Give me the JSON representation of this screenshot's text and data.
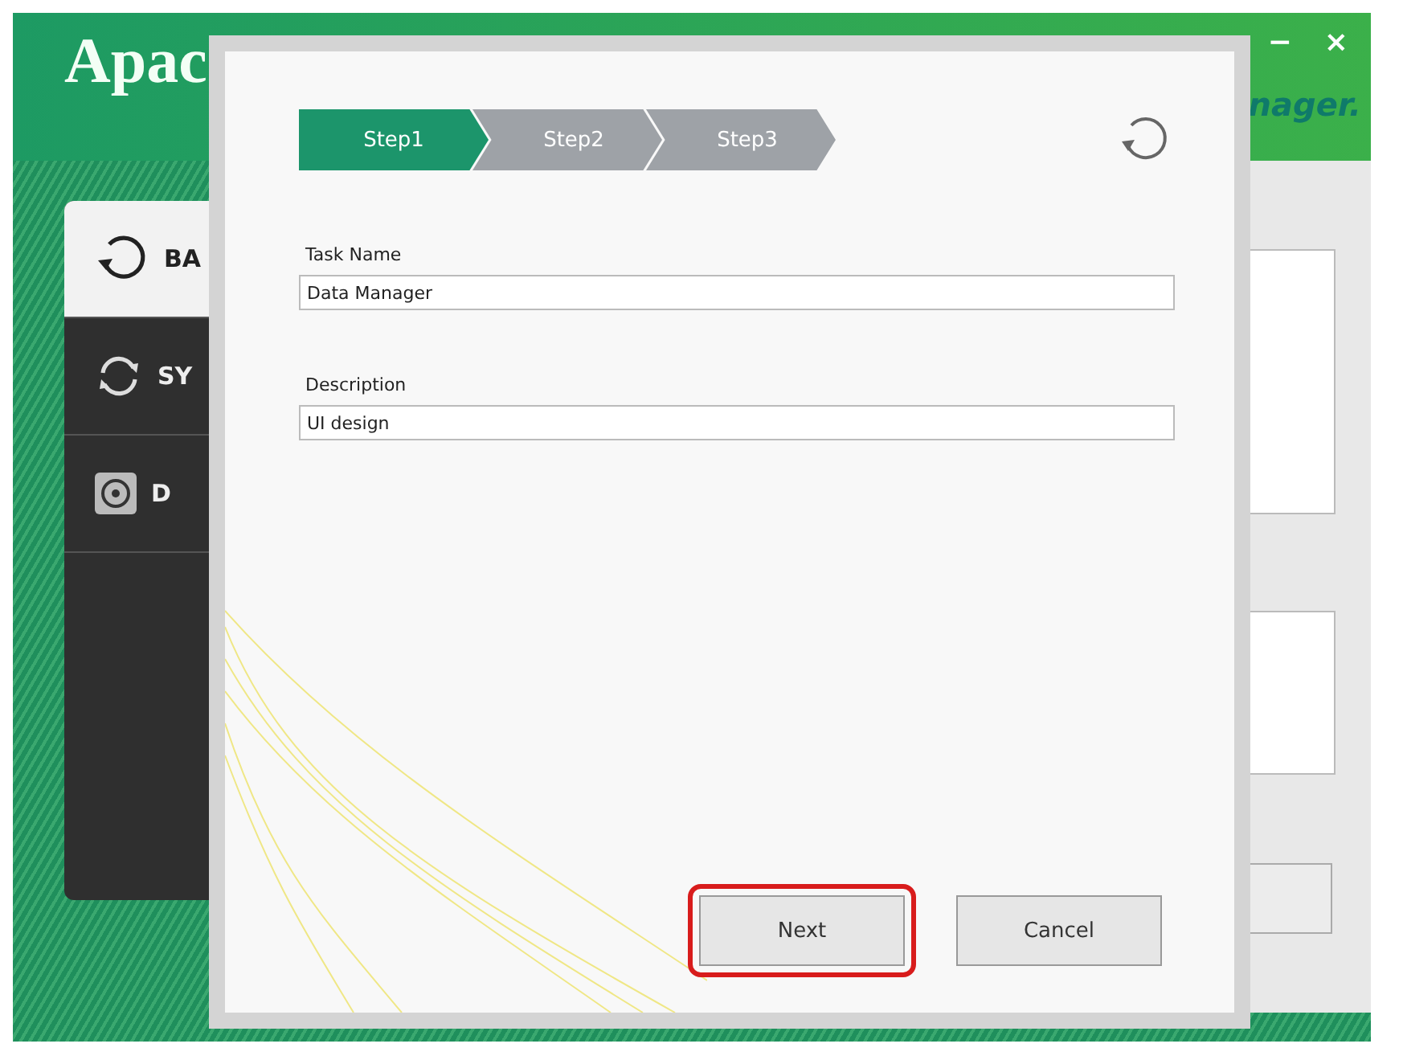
{
  "app_window": {
    "title": "Apac",
    "subtitle": "nager.",
    "window_controls": [
      "−",
      "×"
    ],
    "sidebar": {
      "items": [
        {
          "kind": "backup",
          "label": "BA",
          "selected": true
        },
        {
          "kind": "sync",
          "label": "SY",
          "selected": false
        },
        {
          "kind": "disk",
          "label": "D",
          "selected": false
        }
      ]
    }
  },
  "dialog": {
    "steps": [
      {
        "label": "Step1",
        "selected": true
      },
      {
        "label": "Step2",
        "selected": false
      },
      {
        "label": "Step3",
        "selected": false
      }
    ],
    "fields": [
      {
        "label": "Task Name",
        "value": "Data Manager"
      },
      {
        "label": "Description",
        "value": "UI design"
      }
    ],
    "buttons": [
      {
        "label": "Next",
        "highlighted": true
      },
      {
        "label": "Cancel",
        "highlighted": false
      }
    ]
  }
}
